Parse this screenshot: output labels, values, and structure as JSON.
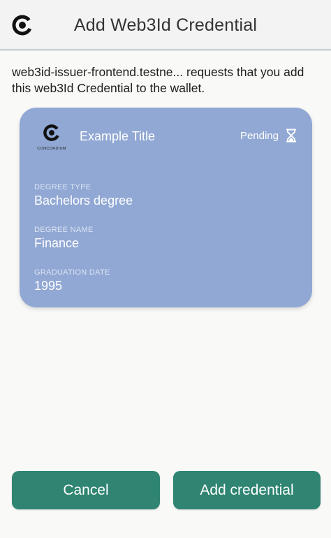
{
  "header": {
    "title": "Add Web3Id Credential",
    "logo_icon": "concordium-logo-icon"
  },
  "intro": {
    "text": "web3id-issuer-frontend.testne... requests that you add this web3Id Credential to the wallet."
  },
  "card": {
    "background_color": "#91a8d4",
    "issuer_name": "CONCORDIUM",
    "title": "Example Title",
    "status": "Pending",
    "status_icon": "hourglass-icon",
    "fields": [
      {
        "label": "DEGREE TYPE",
        "value": "Bachelors degree"
      },
      {
        "label": "DEGREE NAME",
        "value": "Finance"
      },
      {
        "label": "GRADUATION DATE",
        "value": "1995"
      }
    ]
  },
  "actions": {
    "cancel_label": "Cancel",
    "add_label": "Add credential",
    "button_color": "#2f8472"
  }
}
